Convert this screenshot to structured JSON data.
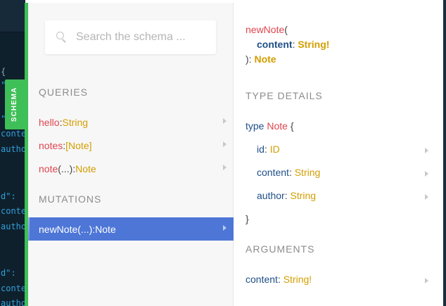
{
  "schema_tab": {
    "label": "SCHEMA"
  },
  "search": {
    "placeholder": "Search the schema ..."
  },
  "editor_fragments": [
    {
      "text": "{",
      "cls": "c-punct"
    },
    {
      "text": "\"",
      "cls": "c-key"
    },
    {
      "text": "\"",
      "cls": "c-key"
    },
    {
      "text": "conte",
      "cls": "c-key"
    },
    {
      "text": "autho",
      "cls": "c-key"
    },
    {
      "text": "d\":",
      "cls": "c-key"
    },
    {
      "text": "conte",
      "cls": "c-key"
    },
    {
      "text": "autho",
      "cls": "c-key"
    },
    {
      "text": "d\":",
      "cls": "c-key"
    },
    {
      "text": "conte",
      "cls": "c-key"
    },
    {
      "text": "autho",
      "cls": "c-key"
    }
  ],
  "left": {
    "queries_title": "QUERIES",
    "queries": [
      {
        "name": "hello",
        "args": "",
        "sep": ": ",
        "type": "String"
      },
      {
        "name": "notes",
        "args": "",
        "sep": ": ",
        "type": "[Note]"
      },
      {
        "name": "note",
        "args": "(...)",
        "sep": ": ",
        "type": "Note"
      }
    ],
    "mutations_title": "MUTATIONS",
    "mutations": [
      {
        "name": "newNote",
        "args": "(...)",
        "sep": ": ",
        "type": "Note"
      }
    ]
  },
  "right": {
    "signature": {
      "name": "newNote",
      "open": "(",
      "arg_name": "content",
      "arg_sep": ": ",
      "arg_type": "String!",
      "close": "): ",
      "return_type": "Note"
    },
    "type_details_title": "TYPE DETAILS",
    "type_keyword": "type",
    "type_name": "Note",
    "open_brace": "{",
    "close_brace": "}",
    "fields": [
      {
        "name": "id",
        "sep": ": ",
        "type": "ID"
      },
      {
        "name": "content",
        "sep": ": ",
        "type": "String"
      },
      {
        "name": "author",
        "sep": ": ",
        "type": "String"
      }
    ],
    "arguments_title": "ARGUMENTS",
    "arguments": [
      {
        "name": "content",
        "sep": ": ",
        "type": "String!"
      }
    ]
  }
}
